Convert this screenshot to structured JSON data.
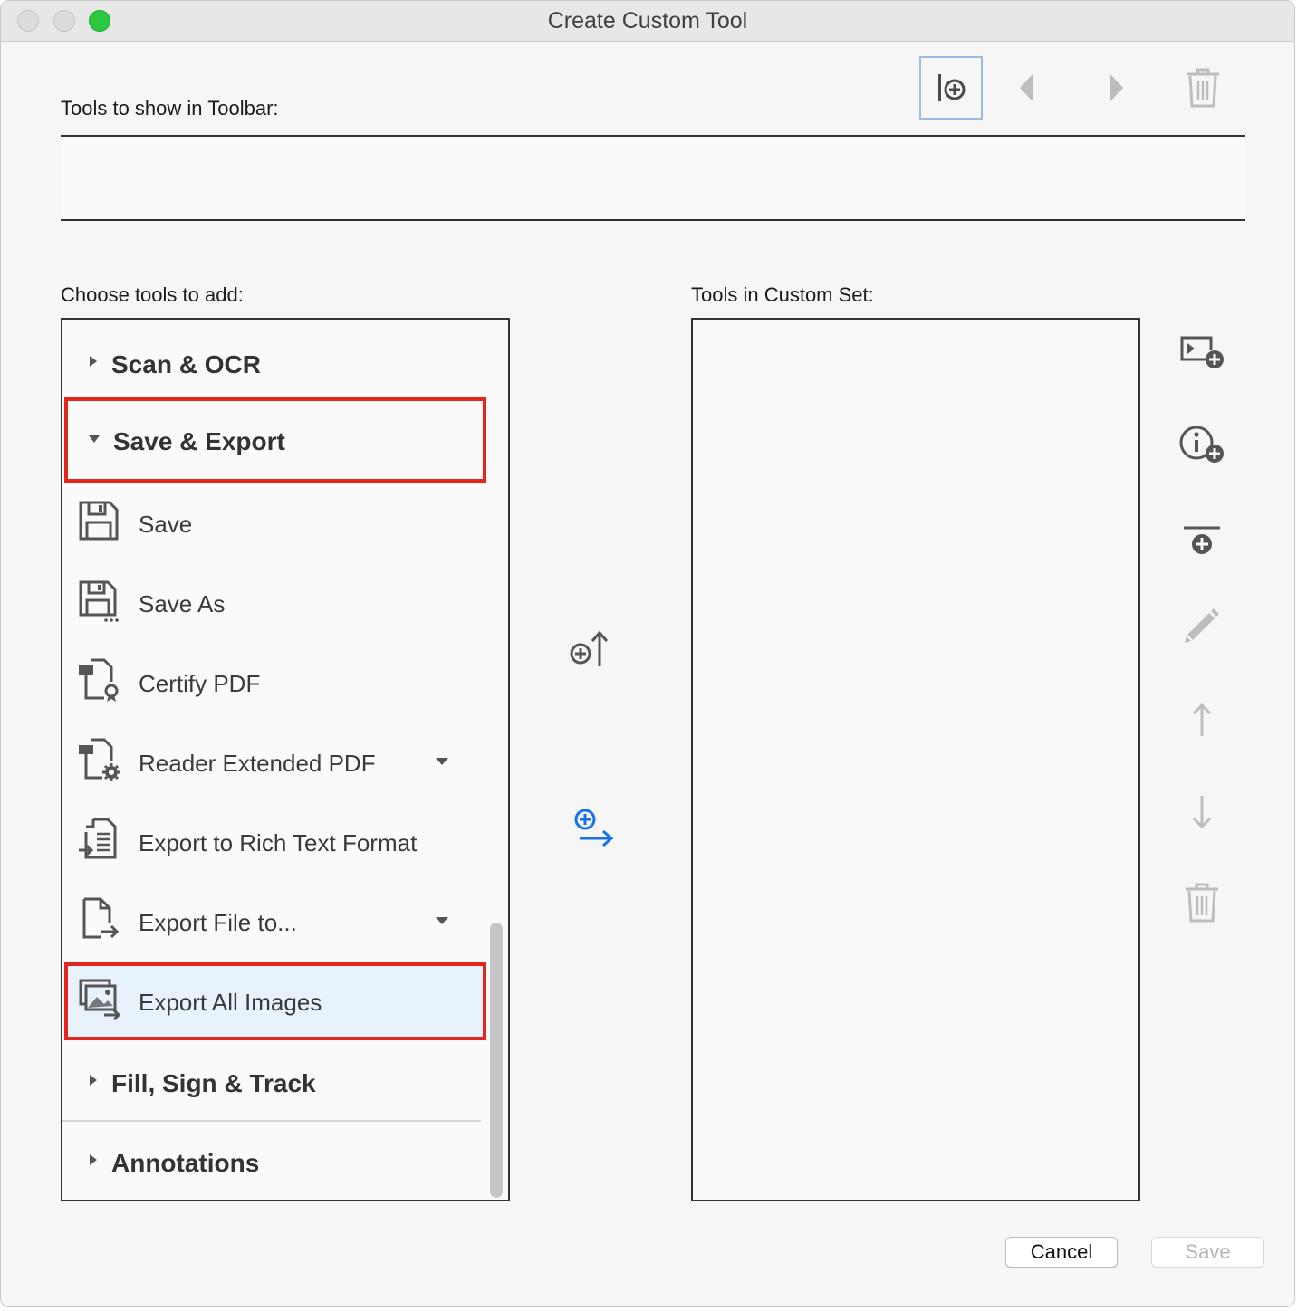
{
  "window": {
    "title": "Create Custom Tool"
  },
  "toolbar_section": {
    "label": "Tools to show in Toolbar:"
  },
  "left_panel": {
    "label": "Choose tools to add:",
    "groups": [
      {
        "label": "Scan & OCR",
        "expanded": false
      },
      {
        "label": "Save & Export",
        "expanded": true,
        "highlighted": true
      },
      {
        "label": "Fill, Sign & Track",
        "expanded": false
      },
      {
        "label": "Annotations",
        "expanded": false
      }
    ],
    "tools": [
      {
        "label": "Save",
        "icon": "save-icon"
      },
      {
        "label": "Save As",
        "icon": "save-as-icon"
      },
      {
        "label": "Certify PDF",
        "icon": "certify-pdf-icon"
      },
      {
        "label": "Reader Extended PDF",
        "icon": "reader-extended-pdf-icon",
        "has_dropdown": true
      },
      {
        "label": "Export to Rich Text Format",
        "icon": "export-rtf-icon"
      },
      {
        "label": "Export File to...",
        "icon": "export-file-icon",
        "has_dropdown": true
      },
      {
        "label": "Export All Images",
        "icon": "export-images-icon",
        "selected": true,
        "highlighted": true
      }
    ]
  },
  "right_panel": {
    "label": "Tools in Custom Set:",
    "items": []
  },
  "buttons": {
    "cancel": "Cancel",
    "save": "Save"
  },
  "colors": {
    "highlight": "#e3251d",
    "selected_row": "#e8f2fd",
    "accent_blue": "#1473e6",
    "disabled_icon": "#bdbdbd"
  }
}
